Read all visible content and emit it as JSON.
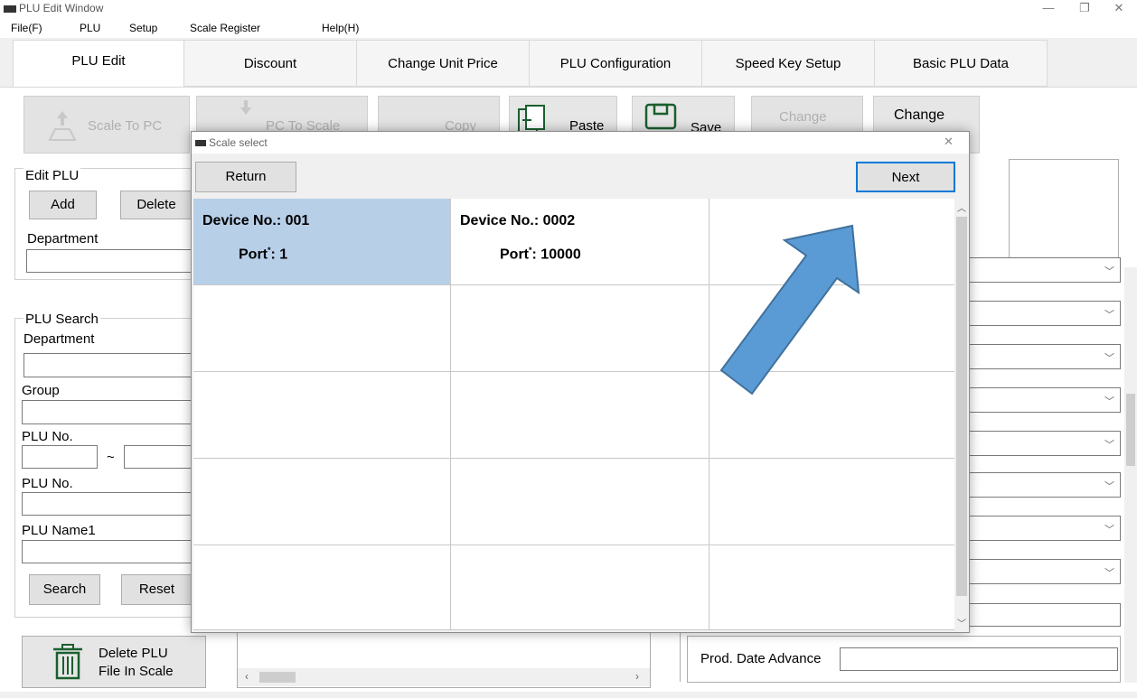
{
  "window": {
    "title": "PLU Edit Window",
    "min": "—",
    "max": "❐",
    "close": "✕"
  },
  "menu": [
    "File(F)",
    "PLU",
    "Setup",
    "Scale Register",
    "Help(H)"
  ],
  "tabs": [
    "PLU Edit",
    "Discount",
    "Change Unit Price",
    "PLU Configuration",
    "Speed Key Setup",
    "Basic PLU Data"
  ],
  "toolbar": {
    "scale_to_pc": "Scale To PC",
    "pc_to_scale": "PC To Scale",
    "copy": "Copy",
    "paste": "Paste",
    "save": "Save",
    "change1": "Change",
    "change2": "Change"
  },
  "edit_plu": {
    "legend": "Edit PLU",
    "add": "Add",
    "delete": "Delete",
    "department": "Department"
  },
  "plu_search": {
    "legend": "PLU Search",
    "department": "Department",
    "group": "Group",
    "plu_no": "PLU No.",
    "tilde": "~",
    "plu_no2": "PLU No.",
    "plu_name1": "PLU Name1",
    "search": "Search",
    "reset": "Reset"
  },
  "delete_plu": {
    "line1": "Delete PLU",
    "line2": "File In Scale"
  },
  "prod_date_advance": "Prod. Date Advance",
  "dialog": {
    "title": "Scale select",
    "close": "✕",
    "return": "Return",
    "next": "Next",
    "devices": [
      {
        "device_label": "Device No.: 001",
        "port_label": "Port",
        "port_value": ": 1"
      },
      {
        "device_label": "Device No.: 0002",
        "port_label": "Port",
        "port_value": ": 10000"
      }
    ],
    "asterisk": "*"
  },
  "colors": {
    "selected_cell": "#b8cfe8",
    "arrow": "#5b9bd5",
    "arrow_border": "#41719c"
  }
}
